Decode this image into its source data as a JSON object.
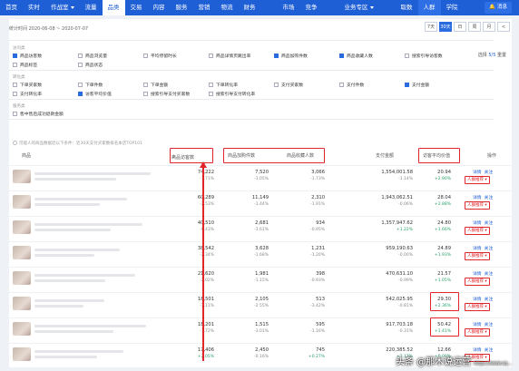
{
  "nav": {
    "items": [
      {
        "label": "首页"
      },
      {
        "label": "实时"
      },
      {
        "label": "作战室",
        "dropdown": true
      },
      {
        "label": "流量"
      },
      {
        "label": "品类",
        "active": true
      },
      {
        "label": "交易"
      },
      {
        "label": "内容"
      },
      {
        "label": "服务"
      },
      {
        "label": "营销"
      },
      {
        "label": "物流"
      },
      {
        "label": "财务"
      },
      {
        "label": "市场",
        "gap": true
      },
      {
        "label": "竞争"
      },
      {
        "label": "业务专区",
        "dropdown": true,
        "gap": true
      },
      {
        "label": "取数",
        "gap": true
      },
      {
        "label": "人群",
        "highlight": true
      },
      {
        "label": "学院"
      }
    ],
    "bell_label": "消息"
  },
  "date": {
    "label": "统计时间 2020-06-08 ~ 2020-07-07"
  },
  "range_buttons": [
    {
      "label": "7天"
    },
    {
      "label": "30天",
      "on": true
    },
    {
      "label": "日"
    },
    {
      "label": "周"
    },
    {
      "label": "月"
    },
    {
      "label": "<"
    }
  ],
  "selected_count": {
    "prefix": "选择 ",
    "value": "5/5",
    "suffix": " 重置"
  },
  "groups": [
    {
      "label": "访问类",
      "rows": [
        [
          {
            "t": "商品访客数",
            "on": true
          },
          {
            "t": "商品浏览量",
            "on": false
          },
          {
            "t": "平均停留时长",
            "on": false
          },
          {
            "t": "商品详情页跳出率",
            "on": false
          },
          {
            "t": "商品加购件数",
            "on": true
          },
          {
            "t": "商品收藏人数",
            "on": true
          },
          {
            "t": "搜索引导访客数",
            "on": false
          }
        ],
        [
          {
            "t": "商品标签",
            "on": false
          },
          {
            "t": "商品状态",
            "on": false
          }
        ]
      ]
    },
    {
      "label": "转化类",
      "rows": [
        [
          {
            "t": "下单买家数",
            "on": false
          },
          {
            "t": "下单件数",
            "on": false
          },
          {
            "t": "下单金额",
            "on": false
          },
          {
            "t": "下单转化率",
            "on": false
          },
          {
            "t": "支付买家数",
            "on": false
          },
          {
            "t": "支付件数",
            "on": false
          },
          {
            "t": "支付金额",
            "on": true
          }
        ],
        [
          {
            "t": "支付转化率",
            "on": false
          },
          {
            "t": "访客平均价值",
            "on": true
          },
          {
            "t": "搜索引导支付买家数",
            "on": false
          },
          {
            "t": "搜索引导支付转化率",
            "on": false
          }
        ]
      ]
    },
    {
      "label": "服务类",
      "rows": [
        [
          {
            "t": "售中售后成功退款金额",
            "on": false
          }
        ]
      ]
    }
  ],
  "note": "可能人的商品数据近以下条件：近30天支付买家数排名本店TOP101",
  "table": {
    "headers": {
      "product": "商品",
      "visitors": "商品访客数",
      "sort_icon": "⇣",
      "addcart": "商品加购件数",
      "favs": "商品收藏人数",
      "pay": "支付金额",
      "avgval": "访客平均价值",
      "op": "操作"
    },
    "rows": [
      {
        "v": "74,222",
        "vp": "-1.71%",
        "a": "7,520",
        "ap": "-1.05%",
        "f": "3,066",
        "fp": "-1.73%",
        "p": "1,554,001.58",
        "pp": "-1.14%",
        "g": "20.94",
        "gp": "+2.90%"
      },
      {
        "v": "60,289",
        "vp": "-2.53%",
        "a": "11,149",
        "ap": "-1.44%",
        "f": "2,310",
        "fp": "-1.91%",
        "p": "1,943,062.51",
        "pp": "-0.06%",
        "g": "28.04",
        "gp": "+2.88%"
      },
      {
        "v": "40,510",
        "vp": "-0.43%",
        "a": "2,681",
        "ap": "-1.61%",
        "f": "934",
        "fp": "-0.95%",
        "p": "1,357,947.62",
        "pp": "+1.22%",
        "g": "24.80",
        "gp": "+1.66%"
      },
      {
        "v": "38,542",
        "vp": "-2.34%",
        "a": "3,628",
        "ap": "-1.68%",
        "f": "1,231",
        "fp": "-1.20%",
        "p": "959,190.63",
        "pp": "-0.00%",
        "g": "24.89",
        "gp": "+1.93%"
      },
      {
        "v": "21,620",
        "vp": "-2.02%",
        "a": "1,981",
        "ap": "-1.15%",
        "f": "398",
        "fp": "-0.93%",
        "p": "470,631.10",
        "pp": "-0.99%",
        "g": "21.57",
        "gp": "+1.05%"
      },
      {
        "v": "18,501",
        "vp": "-3.11%",
        "a": "2,105",
        "ap": "-2.55%",
        "f": "513",
        "fp": "-3.42%",
        "p": "542,025.95",
        "pp": "-0.81%",
        "g": "29.30",
        "gp": "+2.36%"
      },
      {
        "v": "18,201",
        "vp": "-1.72%",
        "a": "1,515",
        "ap": "-3.01%",
        "f": "595",
        "fp": "-1.16%",
        "p": "917,703.18",
        "pp": "-0.31%",
        "g": "50.42",
        "gp": "+1.41%"
      },
      {
        "v": "17,406",
        "vp": "+2.05%",
        "a": "2,450",
        "ap": "-0.16%",
        "f": "745",
        "fp": "+0.27%",
        "p": "220,385.52",
        "pp": "+2.17%",
        "g": "12.66",
        "gp": "+0.00%"
      }
    ],
    "action_detail": "详情",
    "action_follow": "关注",
    "action_crowd": "人群推荐 ▾"
  },
  "watermark": {
    "main": "头条 @那木说运营",
    "sub": "https://www.sq..."
  },
  "colors": {
    "brand": "#1f5fd6",
    "highlight_box": "#e0262b",
    "up": "#2aa06a"
  }
}
